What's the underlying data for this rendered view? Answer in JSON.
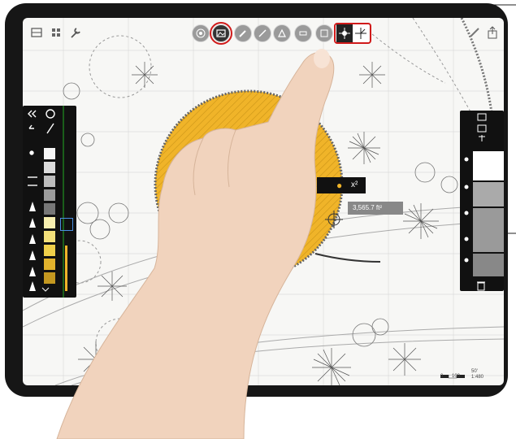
{
  "toolbar": {
    "left_icons": [
      "layers-grid-icon",
      "grid-icon",
      "wrench-icon"
    ],
    "center_icons": [
      "hide-icon",
      "image-icon",
      "brush-icon",
      "pencil-icon",
      "pen-icon",
      "eraser-icon",
      "circle-icon",
      "square-icon",
      "snap-point-icon",
      "snap-angle-icon"
    ],
    "right_icons": [
      "ruler-icon",
      "share-icon"
    ]
  },
  "context_menu": {
    "fill_icon": "fill-drop-icon",
    "power_label": "x²",
    "measurement": "3,565.7 ft²"
  },
  "scale_bar": {
    "ticks": [
      "0",
      "100",
      "50'",
      "1:480"
    ]
  },
  "colors": {
    "highlight": "#d01a1a",
    "shape_fill": "#f0b429",
    "panel": "#111111",
    "tablet_bezel": "#161616"
  },
  "palette": [
    "#f6f6f6",
    "#dcdcdc",
    "#bdbdbd",
    "#9c9c9c",
    "#777777",
    "#f7efb0",
    "#f3e07a",
    "#efcf4a",
    "#e2b22c",
    "#c49820"
  ]
}
